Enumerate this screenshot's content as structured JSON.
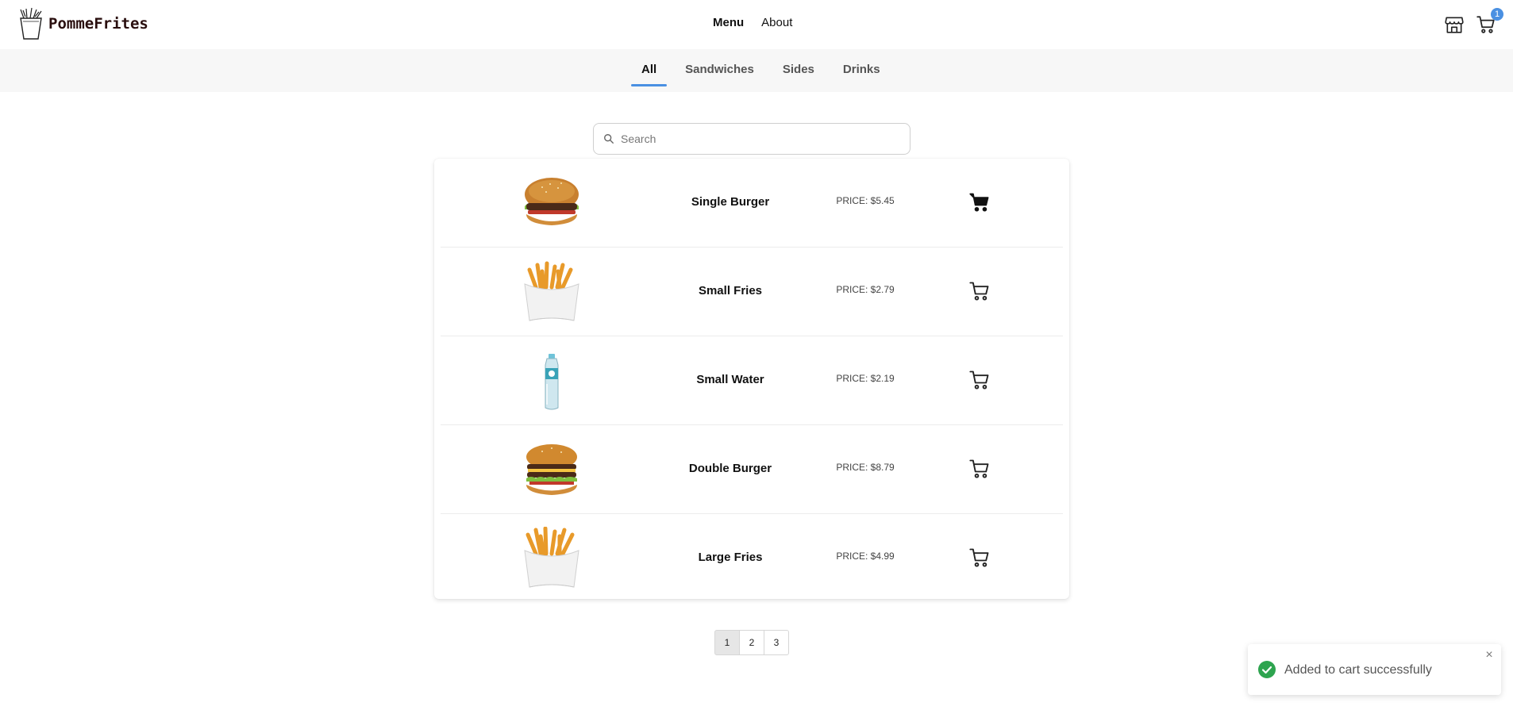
{
  "brand": {
    "name": "PommeFrites"
  },
  "nav": {
    "menu": "Menu",
    "about": "About"
  },
  "cart": {
    "count": "1"
  },
  "tabs": [
    {
      "label": "All",
      "active": true
    },
    {
      "label": "Sandwiches",
      "active": false
    },
    {
      "label": "Sides",
      "active": false
    },
    {
      "label": "Drinks",
      "active": false
    }
  ],
  "search": {
    "placeholder": "Search",
    "value": ""
  },
  "products": [
    {
      "name": "Single Burger",
      "price": "PRICE: $5.45",
      "image": "burger",
      "in_cart": true
    },
    {
      "name": "Small Fries",
      "price": "PRICE: $2.79",
      "image": "fries",
      "in_cart": false
    },
    {
      "name": "Small Water",
      "price": "PRICE: $2.19",
      "image": "water",
      "in_cart": false
    },
    {
      "name": "Double Burger",
      "price": "PRICE: $8.79",
      "image": "double-burger",
      "in_cart": false
    },
    {
      "name": "Large Fries",
      "price": "PRICE: $4.99",
      "image": "fries",
      "in_cart": false
    }
  ],
  "pagination": {
    "pages": [
      "1",
      "2",
      "3"
    ],
    "current": "1"
  },
  "toast": {
    "message": "Added to cart successfully",
    "close": "×"
  },
  "colors": {
    "accent": "#4a90e2",
    "success": "#2ea44f",
    "brand_text": "#2a0f0f"
  },
  "icons": {
    "store": "store-icon",
    "cart": "cart-icon",
    "search": "search-icon",
    "check": "check-circle-icon",
    "close": "close-icon"
  }
}
